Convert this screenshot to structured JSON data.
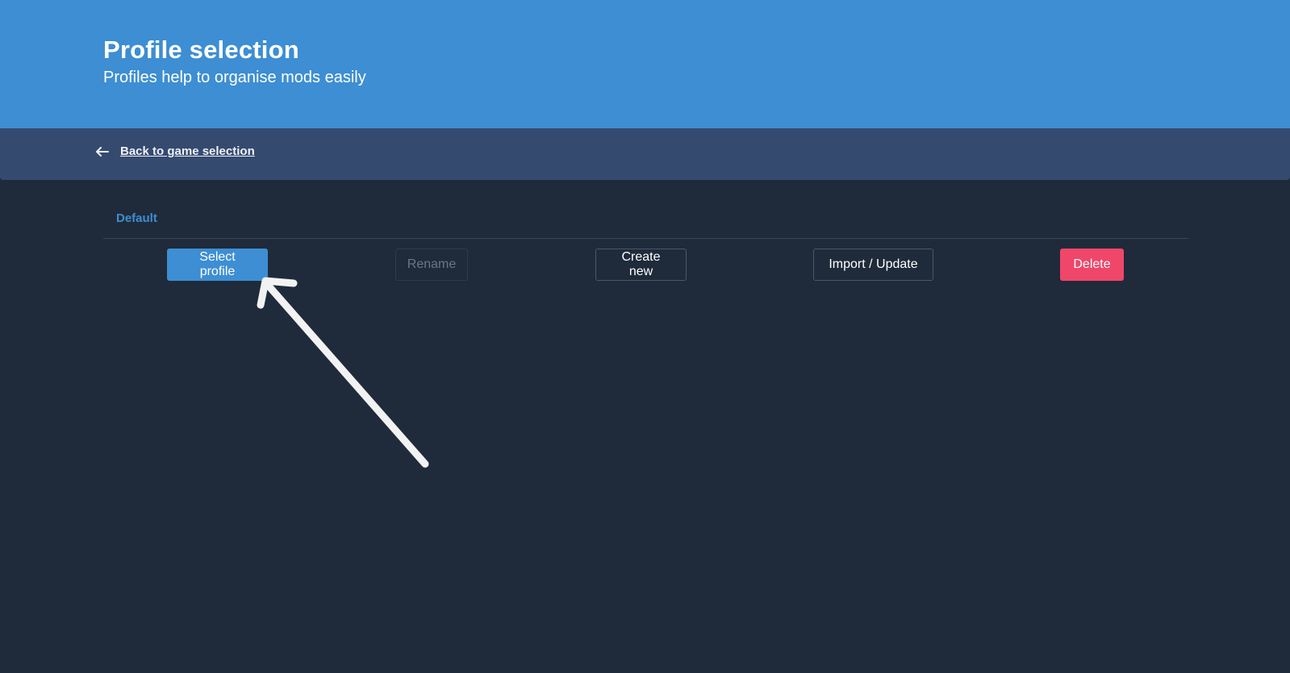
{
  "header": {
    "title": "Profile selection",
    "subtitle": "Profiles help to organise mods easily"
  },
  "nav": {
    "back_label": "Back to game selection",
    "back_icon": "arrow-left-icon"
  },
  "profile": {
    "name": "Default"
  },
  "actions": {
    "select_label": "Select profile",
    "rename_label": "Rename",
    "create_label": "Create new",
    "import_label": "Import / Update",
    "delete_label": "Delete"
  },
  "annotation": {
    "icon": "pointer-arrow-icon"
  },
  "colors": {
    "hero_bg": "#3d8ed3",
    "nav_bg": "#354a6f",
    "page_bg": "#1f2b3a",
    "primary": "#3d8ed3",
    "danger": "#f0466a"
  }
}
